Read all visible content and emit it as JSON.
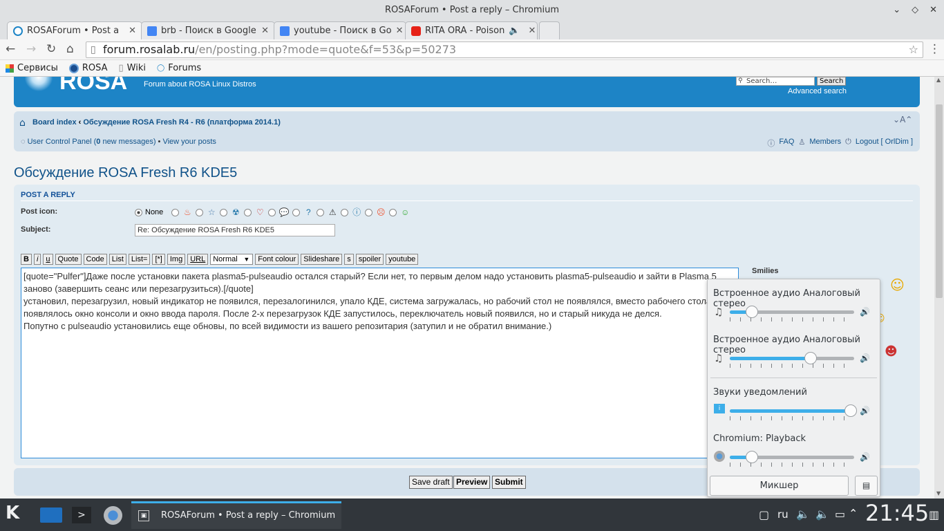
{
  "window": {
    "title": "ROSAForum • Post a reply – Chromium"
  },
  "tabs": [
    {
      "label": "ROSAForum • Post a",
      "color": "#1d84c6",
      "active": true
    },
    {
      "label": "brb - Поиск в Google",
      "color": "#4285f4",
      "active": false
    },
    {
      "label": "youtube - Поиск в Go",
      "color": "#4285f4",
      "active": false
    },
    {
      "label": "RITA ORA - Poison",
      "color": "#e62117",
      "active": false
    }
  ],
  "address": {
    "domain": "forum.rosalab.ru",
    "path": "/en/posting.php?mode=quote&f=53&p=50273"
  },
  "bookmarks": [
    "Сервисы",
    "ROSA",
    "Wiki",
    "Forums"
  ],
  "header": {
    "logo": "ROSA",
    "tagline": "Forum about ROSA Linux Distros",
    "search_placeholder": "Search…",
    "search_button": "Search",
    "advanced_search": "Advanced search"
  },
  "breadcrumb": {
    "board_index": "Board index",
    "separator": "‹",
    "forum": "Обсуждение ROSA Fresh R4 - R6 (платформа 2014.1)",
    "font_size": "A"
  },
  "usernav": {
    "ucp": "User Control Panel (",
    "new_count": "0",
    "new_label": " new messages)",
    "sep": " • ",
    "view_posts": "View your posts",
    "faq": "FAQ",
    "members": "Members",
    "logout": "Logout [ OrlDim ]"
  },
  "page_title": "Обсуждение ROSA Fresh R6 KDE5",
  "form": {
    "heading": "POST A REPLY",
    "post_icon_label": "Post icon:",
    "none_label": "None",
    "subject_label": "Subject:",
    "subject_value": "Re: Обсуждение ROSA Fresh R6 KDE5",
    "bbcode": [
      "B",
      "i",
      "u",
      "Quote",
      "Code",
      "List",
      "List=",
      "[*]",
      "Img",
      "URL"
    ],
    "font_size_select": "Normal",
    "bbcode2": [
      "Font colour",
      "Slideshare",
      "s",
      "spoiler",
      "youtube"
    ],
    "message_lines": [
      "[quote=\"Pulfer\"]Даже после установки пакета plasma5-pulseaudio остался старый? Если нет, то первым делом надо установить plasma5-pulseaudio и зайти в Plasma 5",
      "заново (завершить сеанс или перезагрузиться).[/quote]",
      "установил, перезагрузил, новый индикатор не появился, перезалогинился, упало КДЕ, система загружалась, но рабочий стол не появлялся, вместо рабочего стола",
      "появлялось окно консоли и окно ввода пароля. После 2-х перезагрузок КДЕ запустилось, переключатель новый появился, но и старый никуда не делся.",
      "Попутно с pulseaudio установились еще обновы, по всей видимости из вашего репозитария (затупил и не обратил внимание.)"
    ],
    "smilies_label": "Smilies",
    "save_draft": "Save draft",
    "preview": "Preview",
    "submit": "Submit"
  },
  "volume_popup": {
    "devices": [
      {
        "label": "Встроенное аудио Аналоговый стерео",
        "level": 0.18,
        "icon": "music-note-icon"
      },
      {
        "label": "Встроенное аудио Аналоговый стерео",
        "level": 0.65,
        "icon": "music-note-icon"
      },
      {
        "label": "Звуки уведомлений",
        "level": 0.97,
        "icon": "notification-icon"
      },
      {
        "label": "Chromium: Playback",
        "level": 0.18,
        "icon": "chromium-icon"
      }
    ],
    "mixer_button": "Микшер"
  },
  "taskbar": {
    "task_label": "ROSAForum • Post a reply – Chromium",
    "lang": "ru",
    "clock": "21:45"
  },
  "colors": {
    "accent": "#1d84c6",
    "plasma_blue": "#3daee9",
    "taskbar": "#31363b"
  }
}
